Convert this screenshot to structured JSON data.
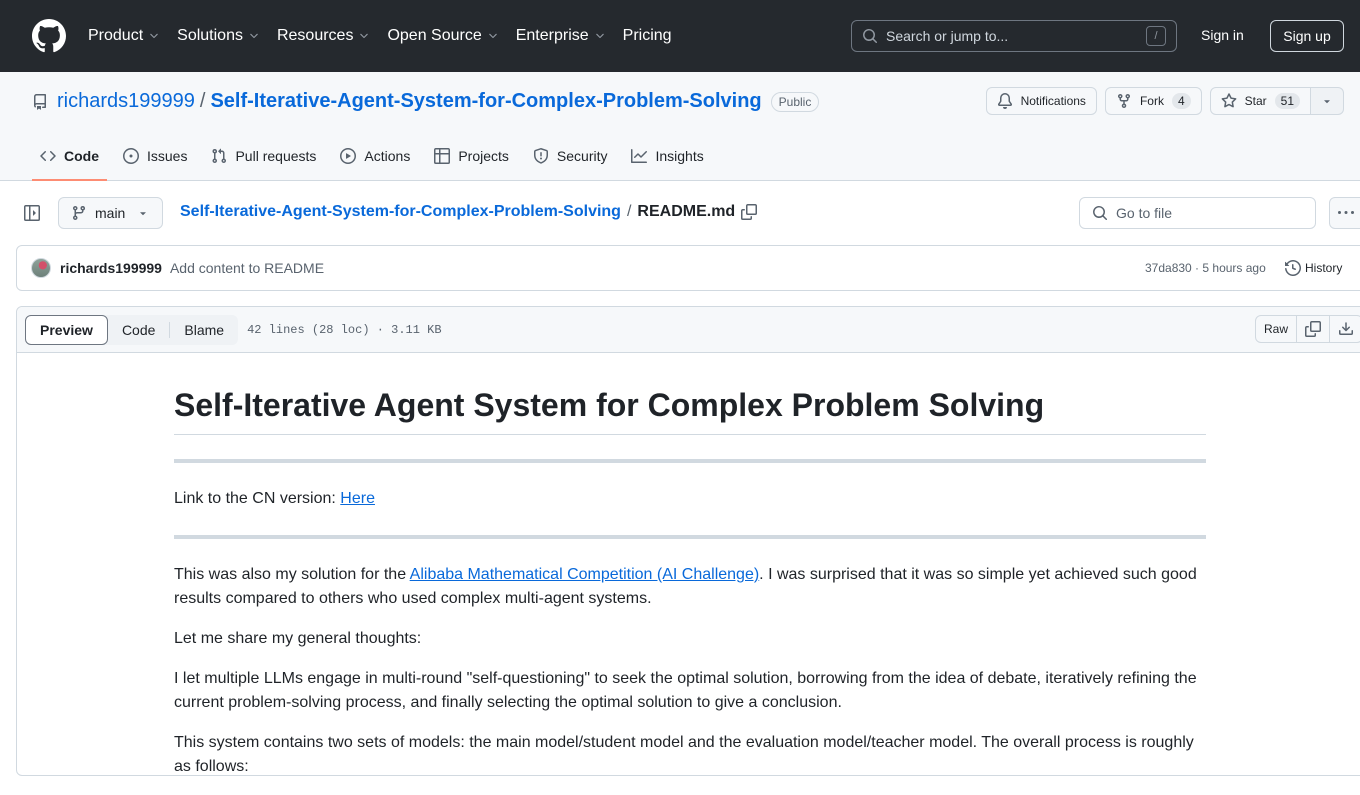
{
  "global_header": {
    "nav": [
      {
        "label": "Product",
        "has_dropdown": true
      },
      {
        "label": "Solutions",
        "has_dropdown": true
      },
      {
        "label": "Resources",
        "has_dropdown": true
      },
      {
        "label": "Open Source",
        "has_dropdown": true
      },
      {
        "label": "Enterprise",
        "has_dropdown": true
      },
      {
        "label": "Pricing",
        "has_dropdown": false
      }
    ],
    "search_placeholder": "Search or jump to...",
    "search_shortcut": "/",
    "sign_in": "Sign in",
    "sign_up": "Sign up"
  },
  "repo": {
    "owner": "richards199999",
    "separator": "/",
    "name": "Self-Iterative-Agent-System-for-Complex-Problem-Solving",
    "visibility": "Public",
    "notifications_label": "Notifications",
    "fork_label": "Fork",
    "fork_count": "4",
    "star_label": "Star",
    "star_count": "51",
    "tabs": [
      {
        "label": "Code",
        "icon": "code-icon",
        "active": true
      },
      {
        "label": "Issues",
        "icon": "issue-icon",
        "active": false
      },
      {
        "label": "Pull requests",
        "icon": "pull-request-icon",
        "active": false
      },
      {
        "label": "Actions",
        "icon": "play-icon",
        "active": false
      },
      {
        "label": "Projects",
        "icon": "table-icon",
        "active": false
      },
      {
        "label": "Security",
        "icon": "shield-icon",
        "active": false
      },
      {
        "label": "Insights",
        "icon": "graph-icon",
        "active": false
      }
    ]
  },
  "file_nav": {
    "branch": "main",
    "breadcrumb_repo": "Self-Iterative-Agent-System-for-Complex-Problem-Solving",
    "breadcrumb_sep": "/",
    "file_name": "README.md",
    "goto_placeholder": "Go to file"
  },
  "commit": {
    "author": "richards199999",
    "message": "Add content to README",
    "sha_time": "37da830 · 5 hours ago",
    "history_label": "History"
  },
  "file_header": {
    "view_tabs": [
      {
        "label": "Preview",
        "active": true
      },
      {
        "label": "Code",
        "active": false
      },
      {
        "label": "Blame",
        "active": false
      }
    ],
    "info": "42 lines (28 loc) · 3.11 KB",
    "raw_label": "Raw"
  },
  "readme": {
    "title": "Self-Iterative Agent System for Complex Problem Solving",
    "cn_link_prefix": "Link to the CN version: ",
    "cn_link_text": "Here",
    "p1_prefix": "This was also my solution for the ",
    "p1_link": "Alibaba Mathematical Competition (AI Challenge)",
    "p1_suffix": ". I was surprised that it was so simple yet achieved such good results compared to others who used complex multi-agent systems.",
    "p2": "Let me share my general thoughts:",
    "p3": "I let multiple LLMs engage in multi-round \"self-questioning\" to seek the optimal solution, borrowing from the idea of debate, iteratively refining the current problem-solving process, and finally selecting the optimal solution to give a conclusion.",
    "p4": "This system contains two sets of models: the main model/student model and the evaluation model/teacher model. The overall process is roughly as follows:"
  }
}
